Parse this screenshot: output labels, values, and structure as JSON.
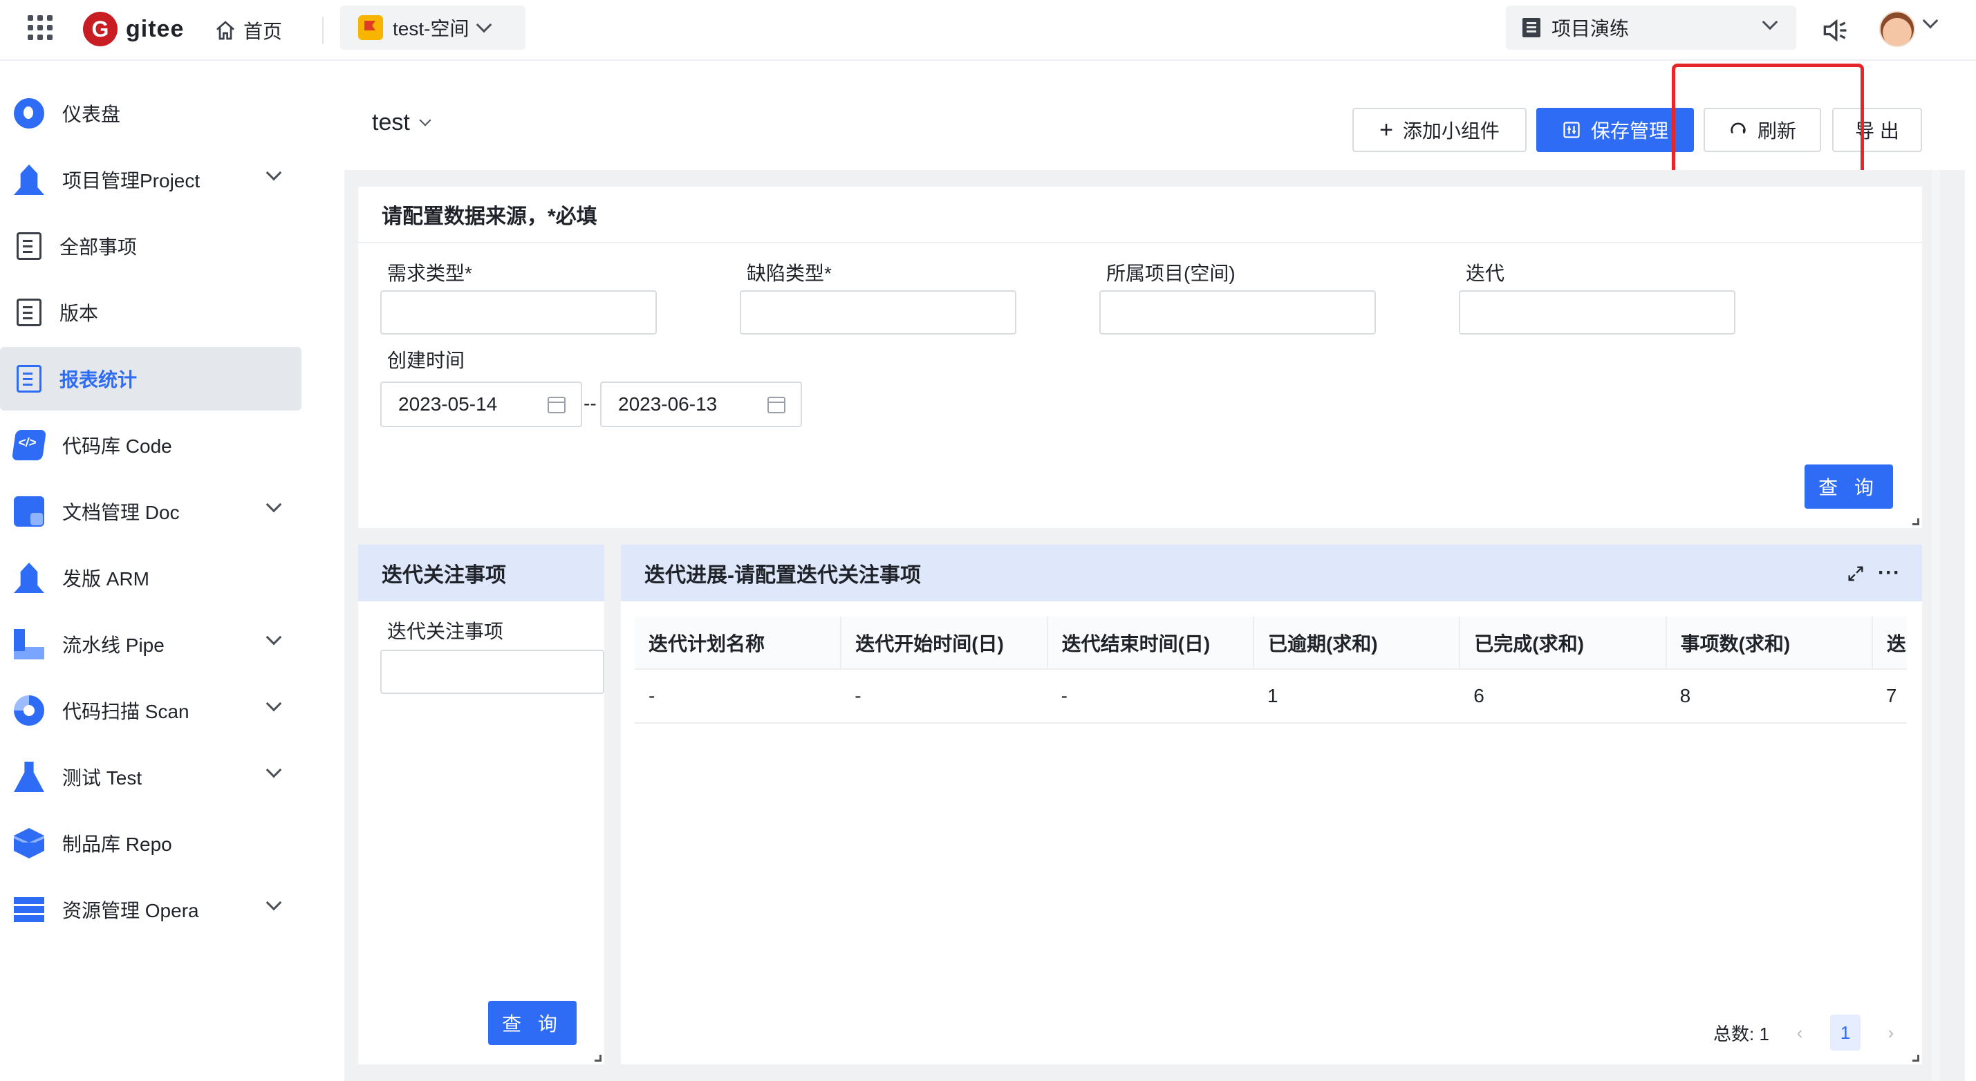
{
  "topbar": {
    "logo_letter": "G",
    "logo_text": "gitee",
    "home_label": "首页",
    "space_label": "test-空间",
    "project_label": "项目演练"
  },
  "sidebar": {
    "items": [
      {
        "label": "仪表盘",
        "icon": "dashboard-icon",
        "expandable": false
      },
      {
        "label": "项目管理Project",
        "icon": "rocket-icon",
        "expandable": true
      },
      {
        "label": "全部事项",
        "icon": "document-list-icon",
        "expandable": false
      },
      {
        "label": "版本",
        "icon": "document-list-icon",
        "expandable": false
      },
      {
        "label": "报表统计",
        "icon": "report-icon",
        "expandable": false,
        "active": true
      },
      {
        "label": "代码库 Code",
        "icon": "code-icon",
        "expandable": false
      },
      {
        "label": "文档管理 Doc",
        "icon": "note-icon",
        "expandable": true
      },
      {
        "label": "发版 ARM",
        "icon": "rocket-icon",
        "expandable": false
      },
      {
        "label": "流水线 Pipe",
        "icon": "pipeline-icon",
        "expandable": true
      },
      {
        "label": "代码扫描 Scan",
        "icon": "scan-icon",
        "expandable": true
      },
      {
        "label": "测试 Test",
        "icon": "flask-icon",
        "expandable": true
      },
      {
        "label": "制品库 Repo",
        "icon": "package-icon",
        "expandable": false
      },
      {
        "label": "资源管理 Opera",
        "icon": "server-icon",
        "expandable": true
      }
    ]
  },
  "header": {
    "title": "test",
    "add_widget": "添加小组件",
    "save_manage": "保存管理",
    "refresh": "刷新",
    "export": "导 出"
  },
  "config_panel": {
    "title": "请配置数据来源，*必填",
    "fields": [
      {
        "label": "需求类型*",
        "value": ""
      },
      {
        "label": "缺陷类型*",
        "value": ""
      },
      {
        "label": "所属项目(空间)",
        "value": ""
      },
      {
        "label": "迭代",
        "value": ""
      }
    ],
    "created_label": "创建时间",
    "date_start": "2023-05-14",
    "date_sep": "--",
    "date_end": "2023-06-13",
    "query_label": "查 询"
  },
  "focus_panel": {
    "title": "迭代关注事项",
    "field_label": "迭代关注事项",
    "query_label": "查 询"
  },
  "progress_panel": {
    "title": "迭代进展-请配置迭代关注事项",
    "columns": [
      "迭代计划名称",
      "迭代开始时间(日)",
      "迭代结束时间(日)",
      "已逾期(求和)",
      "已完成(求和)",
      "事项数(求和)",
      "迭"
    ],
    "rows": [
      [
        "-",
        "-",
        "-",
        "1",
        "6",
        "8",
        "7"
      ]
    ],
    "total_label": "总数: 1",
    "current_page": "1"
  },
  "colors": {
    "accent": "#2e6cf6",
    "highlight_box": "#e5262b",
    "panel_head_blue": "#dfe8fb"
  }
}
